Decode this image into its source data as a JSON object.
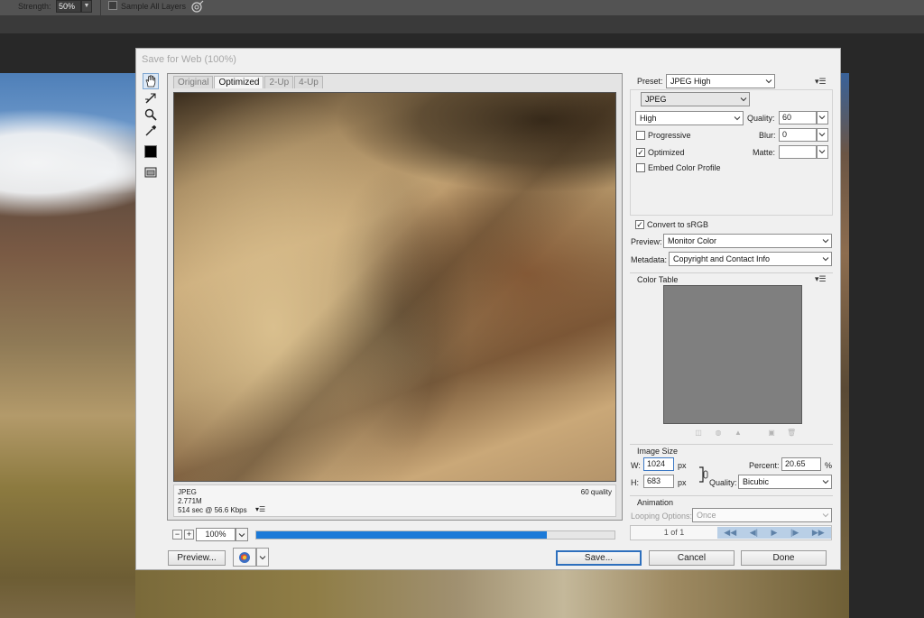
{
  "options_bar": {
    "strength_label": "Strength:",
    "strength_value": "50%",
    "sample_all_layers_label": "Sample All Layers",
    "sample_all_layers_checked": false
  },
  "dialog": {
    "title": "Save for Web (100%)",
    "tabs": [
      {
        "label": "Original",
        "active": false
      },
      {
        "label": "Optimized",
        "active": true
      },
      {
        "label": "2-Up",
        "active": false
      },
      {
        "label": "4-Up",
        "active": false
      }
    ],
    "preview_info": {
      "format": "JPEG",
      "size": "2.771M",
      "time": "514 sec @ 56.6 Kbps",
      "quality": "60 quality"
    },
    "zoom_value": "100%",
    "progress_percent": 81,
    "buttons": {
      "preview": "Preview...",
      "save": "Save...",
      "cancel": "Cancel",
      "done": "Done"
    },
    "settings": {
      "preset_label": "Preset:",
      "preset_value": "JPEG High",
      "format_value": "JPEG",
      "quality_mode": "High",
      "quality_label": "Quality:",
      "quality_value": "60",
      "progressive_label": "Progressive",
      "progressive_checked": false,
      "blur_label": "Blur:",
      "blur_value": "0",
      "optimized_label": "Optimized",
      "optimized_checked": true,
      "matte_label": "Matte:",
      "matte_value": "",
      "embed_color_profile_label": "Embed Color Profile",
      "embed_color_profile_checked": false,
      "convert_srgb_label": "Convert to sRGB",
      "convert_srgb_checked": true,
      "preview_label": "Preview:",
      "preview_value": "Monitor Color",
      "metadata_label": "Metadata:",
      "metadata_value": "Copyright and Contact Info"
    },
    "color_table": {
      "title": "Color Table",
      "swatch_color": "#7f7f7f"
    },
    "image_size": {
      "title": "Image Size",
      "w_label": "W:",
      "w_value": "1024",
      "h_label": "H:",
      "h_value": "683",
      "unit": "px",
      "percent_label": "Percent:",
      "percent_value": "20.65",
      "percent_unit": "%",
      "quality_label": "Quality:",
      "quality_value": "Bicubic"
    },
    "animation": {
      "title": "Animation",
      "looping_label": "Looping Options:",
      "looping_value": "Once",
      "frame_count": "1 of 1"
    }
  },
  "colors": {
    "accent_blue": "#1c7ad8",
    "dialog_bg": "#f0f0f0",
    "app_bar": "#535353"
  }
}
